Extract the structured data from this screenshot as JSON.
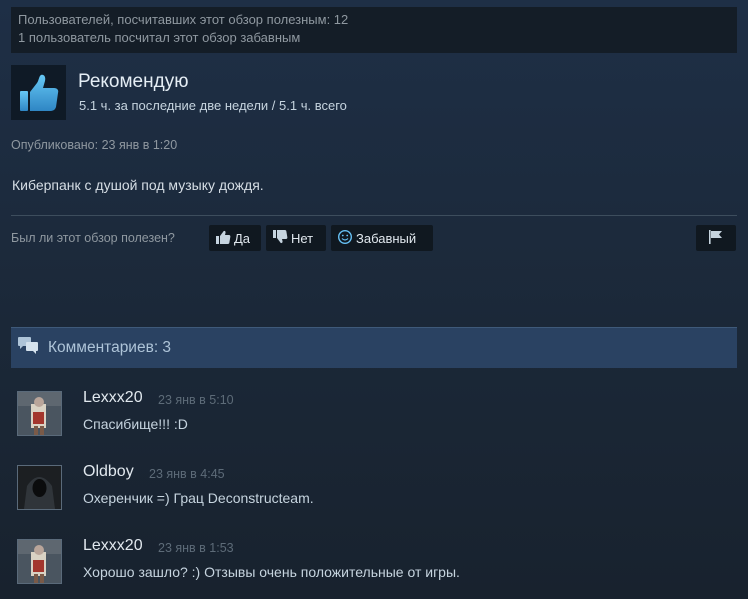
{
  "votes": {
    "helpful_line": "Пользователей, посчитавших этот обзор полезным: 12",
    "funny_line": "1 пользователь посчитал этот обзор забавным"
  },
  "recommendation": {
    "icon": "thumbs-up-icon",
    "title": "Рекомендую",
    "hours": "5.1 ч. за последние две недели / 5.1 ч. всего"
  },
  "posted": "Опубликовано: 23 янв в 1:20",
  "review_text": "Киберпанк с душой под музыку дождя.",
  "helpful": {
    "question": "Был ли этот обзор полезен?",
    "yes": "Да",
    "no": "Нет",
    "funny": "Забавный"
  },
  "comments": {
    "header": "Комментариев: 3",
    "items": [
      {
        "author": "Lexxx20",
        "time": "23 янв в 5:10",
        "text": "Спасибище!!! :D"
      },
      {
        "author": "Oldboy",
        "time": "23 янв в 4:45",
        "text": "Охеренчик =) Грац Deconstructeam."
      },
      {
        "author": "Lexxx20",
        "time": "23 янв в 1:53",
        "text": "Хорошо зашло? :) Отзывы очень положительные от игры."
      }
    ]
  },
  "colors": {
    "accent": "#66c0f4",
    "background": "#1b2838",
    "header_bar": "#2a4262"
  }
}
